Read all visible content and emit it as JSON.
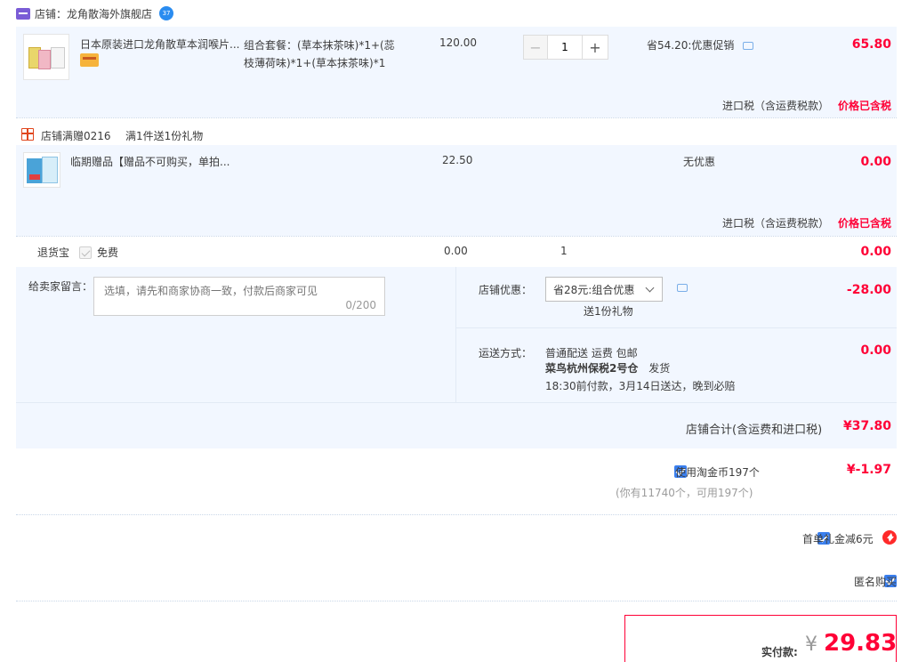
{
  "shop": {
    "label": "店铺：",
    "name": "龙角散海外旗舰店",
    "badge": "37",
    "badge_color": "#2a8cf0",
    "accent": "#7a5cd6"
  },
  "item1": {
    "title": "日本原装进口龙角散草本润喉片...",
    "sku": "组合套餐：(草本抹茶味)*1+(蕊枝薄荷味)*1+(草本抹茶味)*1",
    "price": "120.00",
    "qty": "1",
    "minus": "−",
    "plus": "+",
    "promo": "省54.20:优惠促销",
    "total": "65.80",
    "tax_label": "进口税（含运费税款）",
    "tax_value": "价格已含税"
  },
  "gift": {
    "label": "店铺满赠0216",
    "rule": "满1件送1份礼物",
    "title": "临期赠品【赠品不可购买，单拍...",
    "price": "22.50",
    "promo": "无优惠",
    "total": "0.00",
    "tax_label": "进口税（含运费税款）",
    "tax_value": "价格已含税"
  },
  "returns": {
    "label": "退货宝",
    "free": "免费",
    "price": "0.00",
    "qty": "1",
    "total": "0.00"
  },
  "message": {
    "label": "给卖家留言：",
    "placeholder": "选填，请先和商家协商一致，付款后商家可见",
    "counter": "0/200"
  },
  "discount": {
    "label": "店铺优惠：",
    "selected": "省28元:组合优惠",
    "gift_note": "送1份礼物",
    "value": "-28.00"
  },
  "shipping": {
    "label": "运送方式：",
    "line1": "普通配送 运费 包邮",
    "warehouse": "菜鸟杭州保税2号仓",
    "dispatch": "发货",
    "line3": "18:30前付款，3月14日送达，晚到必赔",
    "value": "0.00"
  },
  "subtotal": {
    "label": "店铺合计(含运费和进口税)",
    "value": "¥37.80"
  },
  "coins": {
    "label": "使用淘金币197个",
    "note": "(你有11740个，可用197个)",
    "value": "¥-1.97"
  },
  "first_order": {
    "label": "首单礼金减6元"
  },
  "anonymous": {
    "label": "匿名购买"
  },
  "pay": {
    "label": "实付款:",
    "currency": "¥",
    "amount": "29.83"
  }
}
